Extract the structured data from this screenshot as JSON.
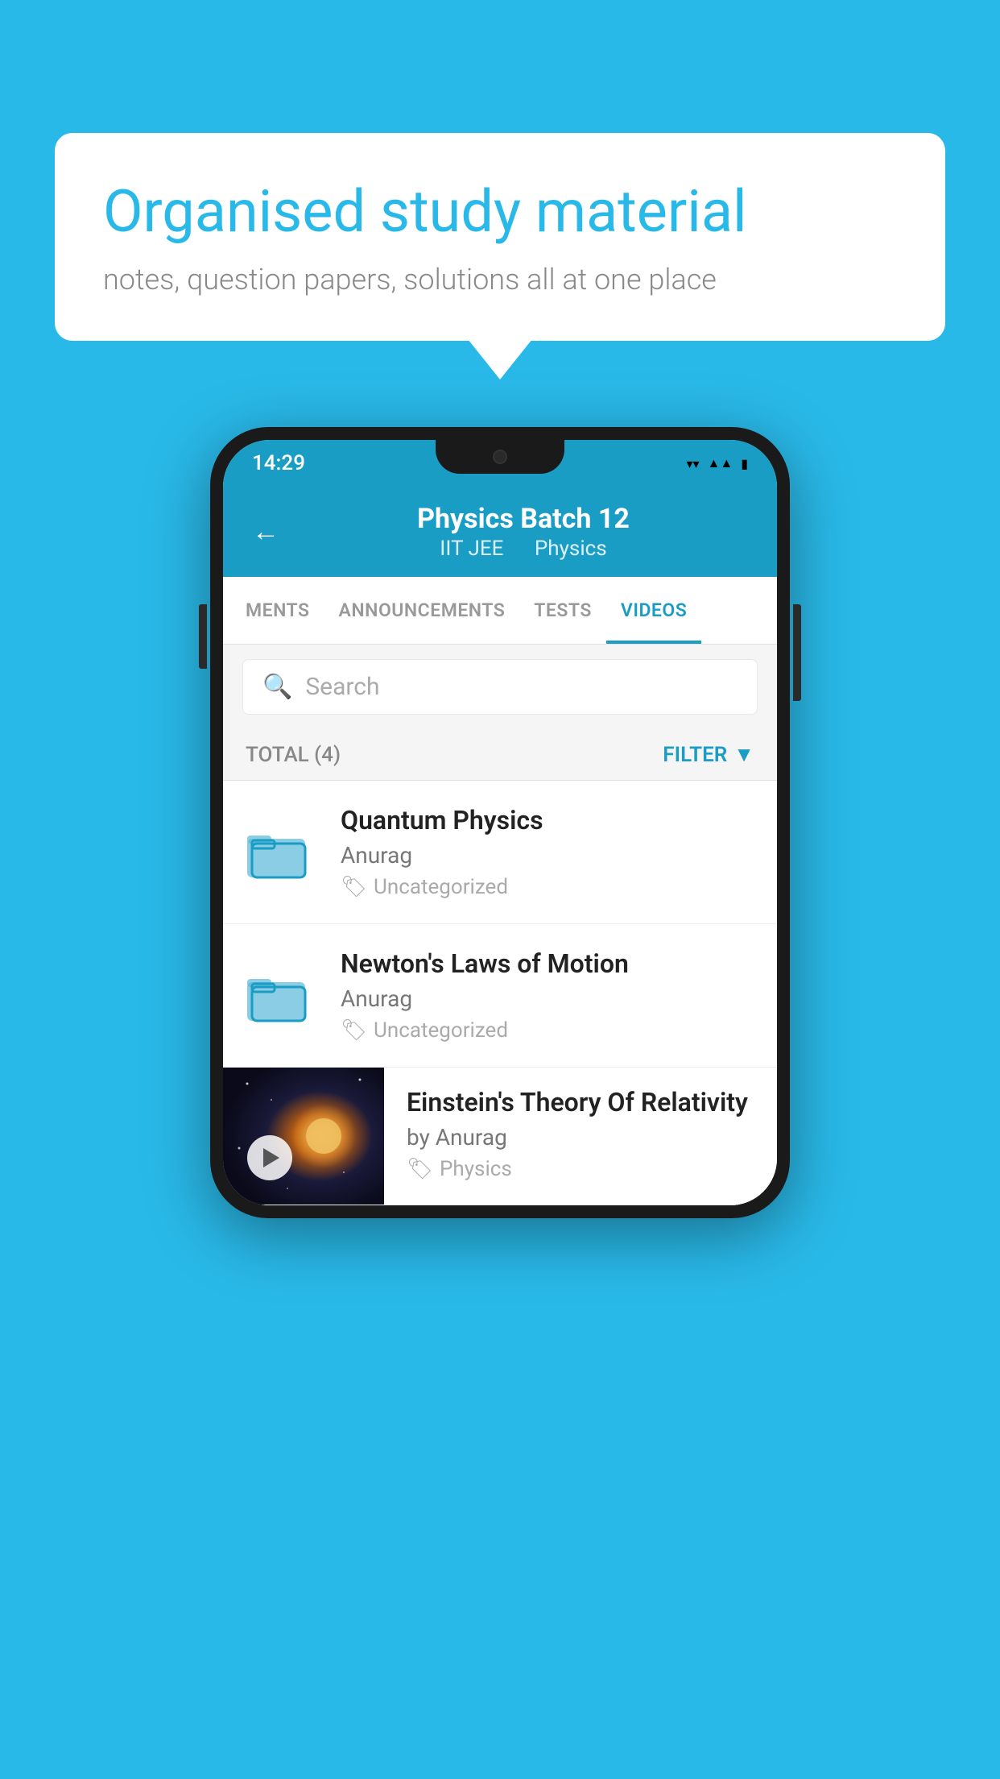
{
  "background": {
    "color": "#29b9e8"
  },
  "bubble": {
    "title": "Organised study material",
    "subtitle": "notes, question papers, solutions all at one place"
  },
  "phone": {
    "status_bar": {
      "time": "14:29"
    },
    "header": {
      "title": "Physics Batch 12",
      "subtitle_left": "IIT JEE",
      "subtitle_right": "Physics",
      "back_label": "←"
    },
    "tabs": [
      {
        "label": "MENTS",
        "active": false
      },
      {
        "label": "ANNOUNCEMENTS",
        "active": false
      },
      {
        "label": "TESTS",
        "active": false
      },
      {
        "label": "VIDEOS",
        "active": true
      }
    ],
    "search": {
      "placeholder": "Search"
    },
    "filter_row": {
      "total_label": "TOTAL (4)",
      "filter_label": "FILTER"
    },
    "videos": [
      {
        "title": "Quantum Physics",
        "author": "Anurag",
        "tag": "Uncategorized",
        "has_thumb": false
      },
      {
        "title": "Newton's Laws of Motion",
        "author": "Anurag",
        "tag": "Uncategorized",
        "has_thumb": false
      },
      {
        "title": "Einstein's Theory Of Relativity",
        "author": "by Anurag",
        "tag": "Physics",
        "has_thumb": true
      }
    ]
  }
}
